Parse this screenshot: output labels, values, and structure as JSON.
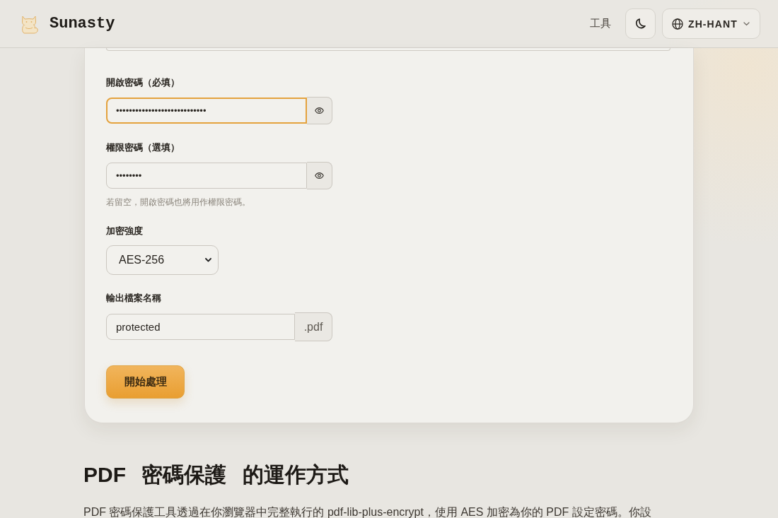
{
  "header": {
    "brand": "Sunasty",
    "nav": [
      {
        "label": "工具"
      }
    ],
    "language": "ZH-HANT"
  },
  "form": {
    "fields": [
      {
        "kind": "password",
        "label": "開啟密碼（必填）",
        "value": "••••••••••••••••••••••••••••",
        "focused": true
      },
      {
        "kind": "password",
        "label": "權限密碼（選填）",
        "value": "••••••••",
        "focused": false,
        "hint": "若留空，開啟密碼也將用作權限密碼。"
      },
      {
        "kind": "select",
        "label": "加密強度",
        "value": "AES-256",
        "focused": false
      },
      {
        "kind": "text",
        "label": "輸出檔案名稱",
        "value": "protected",
        "suffix": ".pdf",
        "focused": false
      }
    ],
    "submit": "開始處理"
  },
  "section": {
    "title": "PDF 密碼保護 的運作方式",
    "body": "PDF 密碼保護工具透過在你瀏覽器中完整執行的 pdf-lib-plus-encrypt，使用 AES 加密為你的 PDF 設定密碼。你設"
  }
}
